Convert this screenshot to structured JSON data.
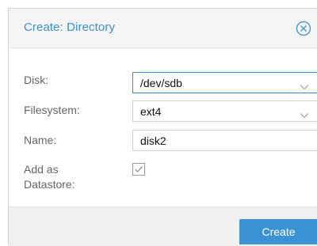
{
  "dialog": {
    "title": "Create: Directory",
    "close_icon": "close-circle-icon"
  },
  "form": {
    "disk": {
      "label": "Disk:",
      "value": "/dev/sdb",
      "icon": "chevron-down-icon"
    },
    "filesystem": {
      "label": "Filesystem:",
      "value": "ext4",
      "icon": "chevron-down-icon"
    },
    "name": {
      "label": "Name:",
      "value": "disk2"
    },
    "add_datastore": {
      "label_line1": "Add as",
      "label_line2": "Datastore:",
      "checked": true,
      "icon": "checkmark-icon"
    }
  },
  "footer": {
    "create_label": "Create"
  },
  "colors": {
    "accent": "#3892d4",
    "label": "#666666",
    "border": "#cfcfcf"
  }
}
